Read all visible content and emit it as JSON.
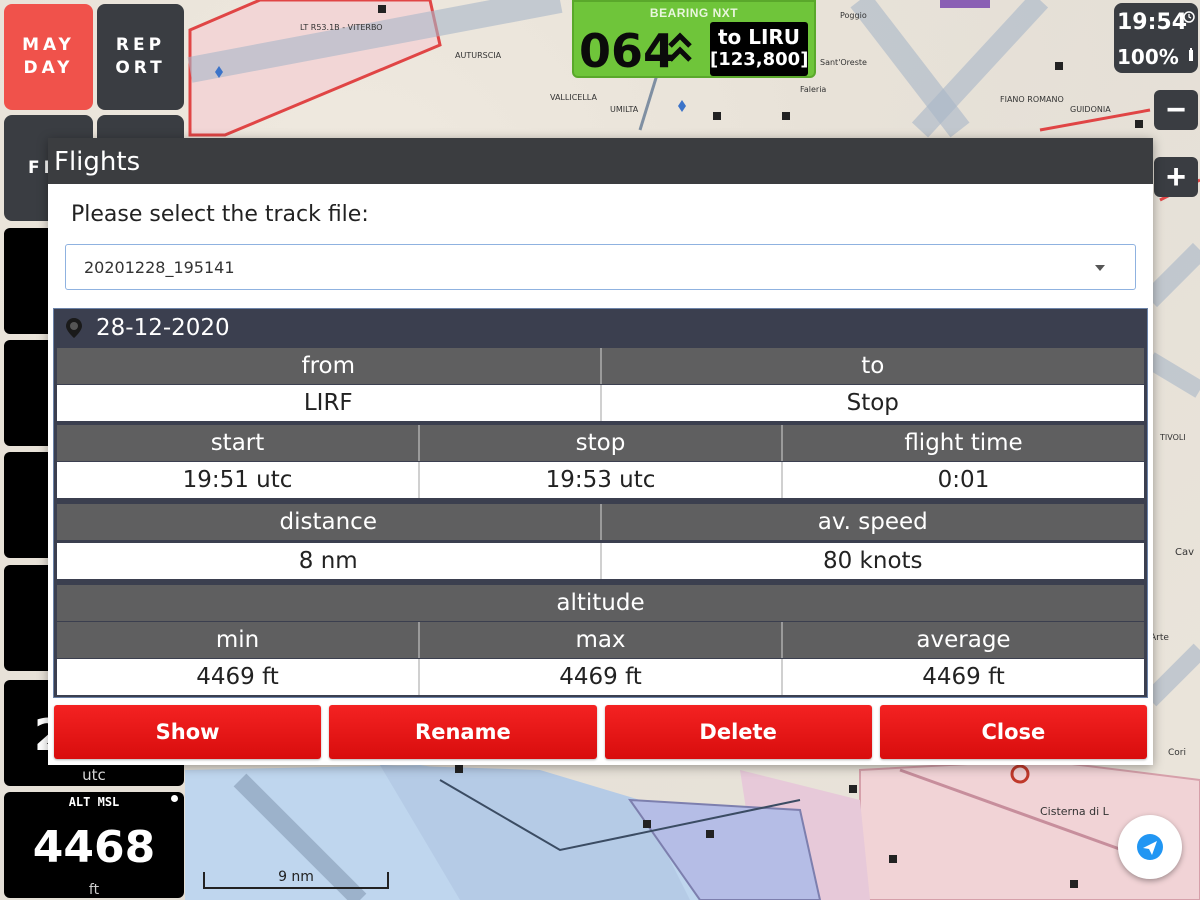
{
  "left_panel": {
    "mayday_label_1": "MAY",
    "mayday_label_2": "DAY",
    "report_label_1": "REP",
    "report_label_2": "ORT",
    "flights_label": "FL T",
    "time_value": "2",
    "time_unit": "utc",
    "alt_label": "ALT MSL",
    "alt_value": "4468",
    "alt_unit": "ft"
  },
  "bearing": {
    "label": "BEARING NXT",
    "value": "064",
    "to_line": "to LIRU",
    "to_dist": "[123,800]"
  },
  "status": {
    "time": "19:54",
    "battery": "100%"
  },
  "zoom": {
    "minus": "−",
    "plus": "+"
  },
  "dialog": {
    "title": "Flights",
    "prompt": "Please select the track file:",
    "select_value": "20201228_195141",
    "date": "28-12-2020",
    "rows": {
      "from_to_headers": [
        "from",
        "to"
      ],
      "from_to_values": [
        "LIRF",
        "Stop"
      ],
      "times_headers": [
        "start",
        "stop",
        "flight time"
      ],
      "times_values": [
        "19:51 utc",
        "19:53 utc",
        "0:01"
      ],
      "dist_headers": [
        "distance",
        "av. speed"
      ],
      "dist_values": [
        "8 nm",
        "80 knots"
      ],
      "alt_header": "altitude",
      "alt_sub_headers": [
        "min",
        "max",
        "average"
      ],
      "alt_values": [
        "4469 ft",
        "4469 ft",
        "4469 ft"
      ]
    },
    "buttons": {
      "show": "Show",
      "rename": "Rename",
      "delete": "Delete",
      "close": "Close"
    }
  },
  "map": {
    "scale_label": "9 nm"
  },
  "colors": {
    "mayday": "#f0524b",
    "bearing": "#6fc53a",
    "action": "#e81515",
    "dark": "#3a3d42"
  }
}
